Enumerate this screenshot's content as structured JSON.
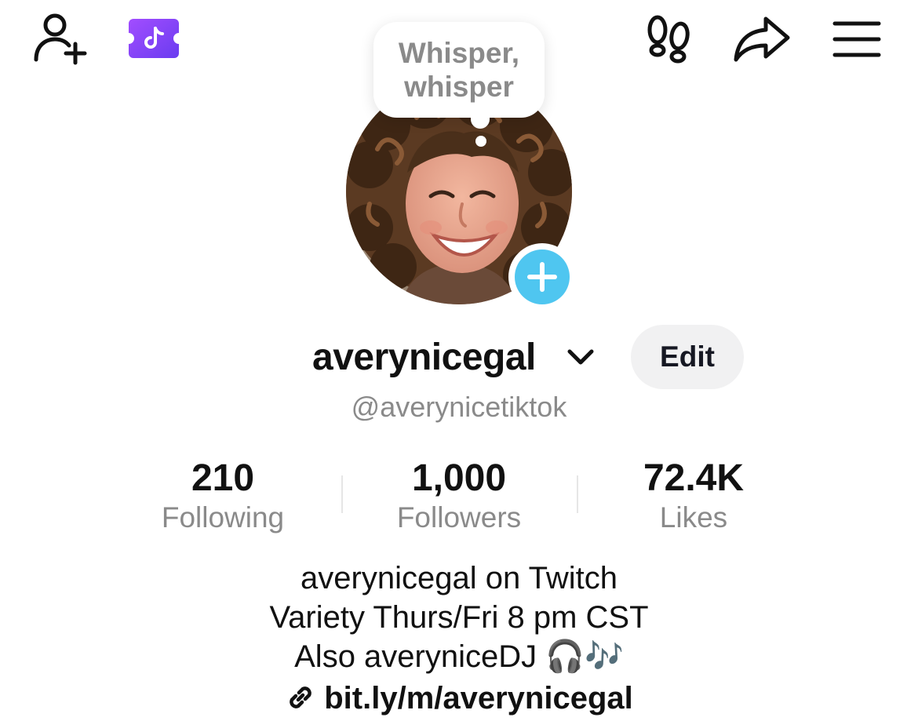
{
  "header": {
    "icons": {
      "add_friend": "add-friend-icon",
      "live_ticket": "tiktok-ticket-icon",
      "visitors": "footprints-icon",
      "share": "share-icon",
      "menu": "hamburger-menu-icon"
    },
    "accent_color": "#8b5cf6"
  },
  "profile": {
    "note": "Whisper, whisper",
    "display_name": "averynicegal",
    "handle": "@averynicetiktok",
    "edit_label": "Edit",
    "add_button_color": "#4fc6f0"
  },
  "stats": [
    {
      "value": "210",
      "label": "Following"
    },
    {
      "value": "1,000",
      "label": "Followers"
    },
    {
      "value": "72.4K",
      "label": "Likes"
    }
  ],
  "bio": {
    "lines": [
      "averynicegal on Twitch",
      "Variety Thurs/Fri 8 pm CST",
      "Also averyniceDJ"
    ],
    "line3_emojis": "🎧🎶",
    "link": "bit.ly/m/averynicegal"
  }
}
